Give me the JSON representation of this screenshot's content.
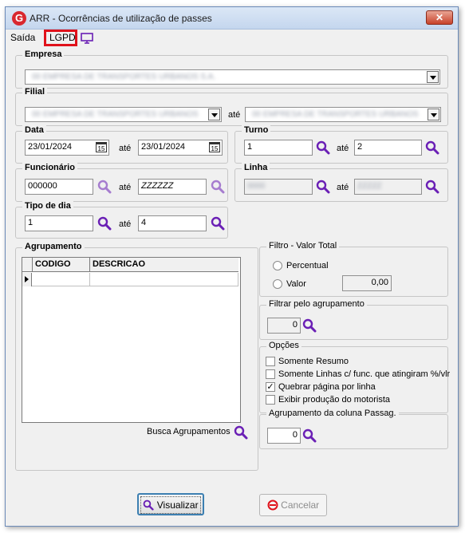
{
  "window": {
    "title": "ARR - Ocorrências de utilização de passes",
    "close_symbol": "✕"
  },
  "menu": {
    "saida": "Saída",
    "lgpd": "LGPD"
  },
  "empresa": {
    "label": "Empresa",
    "value": "00 EMPRESA DE TRANSPORTES URBANOS S.A."
  },
  "filial": {
    "label": "Filial",
    "from": "00 EMPRESA DE TRANSPORTES URBANOS",
    "ate": "até",
    "to": "00 EMPRESA DE TRANSPORTES URBANOS"
  },
  "data": {
    "label": "Data",
    "from": "23/01/2024",
    "ate": "até",
    "to": "23/01/2024",
    "cal_glyph": "15"
  },
  "turno": {
    "label": "Turno",
    "from": "1",
    "ate": "até",
    "to": "2"
  },
  "funcionario": {
    "label": "Funcionário",
    "from": "000000",
    "ate": "até",
    "to": "ZZZZZZ"
  },
  "linha": {
    "label": "Linha",
    "from": "0000",
    "ate": "até",
    "to": "ZZZZZ"
  },
  "tipo_dia": {
    "label": "Tipo de dia",
    "from": "1",
    "ate": "até",
    "to": "4"
  },
  "agrupamento": {
    "label": "Agrupamento",
    "columns": [
      "CODIGO",
      "DESCRICAO"
    ],
    "busca_label": "Busca Agrupamentos"
  },
  "filtro_valor": {
    "label": "Filtro - Valor Total",
    "percentual": "Percentual",
    "valor": "Valor",
    "valor_value": "0,00"
  },
  "filtrar_agrupamento": {
    "label": "Filtrar pelo agrupamento",
    "value": "0"
  },
  "opcoes": {
    "label": "Opções",
    "items": [
      {
        "label": "Somente Resumo",
        "checked": ""
      },
      {
        "label": "Somente Linhas c/ func. que atingiram %/vlr",
        "checked": ""
      },
      {
        "label": "Quebrar página por linha",
        "checked": "✓"
      },
      {
        "label": "Exibir produção do motorista",
        "checked": ""
      }
    ]
  },
  "agrupamento_passag": {
    "label": "Agrupamento  da coluna Passag.",
    "value": "0"
  },
  "buttons": {
    "visualizar": "Visualizar",
    "cancelar": "Cancelar"
  },
  "colors": {
    "accent_icon": "#6a1fb5",
    "highlight": "#e0121b",
    "primary_border": "#3c7fb1"
  }
}
